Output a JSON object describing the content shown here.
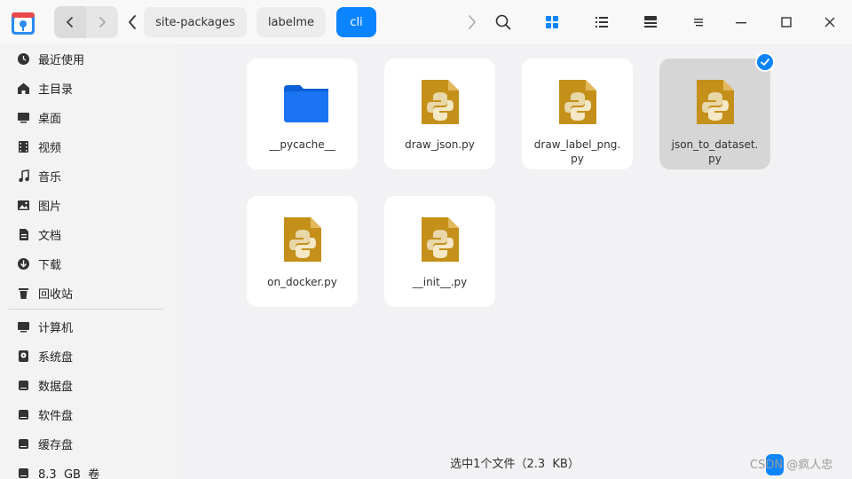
{
  "toolbar": {
    "app_icon": "file-manager-icon",
    "back_icon": "chevron-left-icon",
    "forward_icon": "chevron-right-icon",
    "breadcrumbs": [
      {
        "label": "site-packages",
        "active": false
      },
      {
        "label": "labelme",
        "active": false
      },
      {
        "label": "cli",
        "active": true
      }
    ],
    "accent": "#0a84ff"
  },
  "sidebar": {
    "items": [
      {
        "label": "最近使用",
        "icon": "recent-icon"
      },
      {
        "label": "主目录",
        "icon": "home-icon"
      },
      {
        "label": "桌面",
        "icon": "desktop-icon"
      },
      {
        "label": "视频",
        "icon": "video-icon"
      },
      {
        "label": "音乐",
        "icon": "music-icon"
      },
      {
        "label": "图片",
        "icon": "image-icon"
      },
      {
        "label": "文档",
        "icon": "document-icon"
      },
      {
        "label": "下载",
        "icon": "download-icon"
      },
      {
        "label": "回收站",
        "icon": "trash-icon"
      }
    ],
    "devices": [
      {
        "label": "计算机",
        "icon": "computer-icon"
      },
      {
        "label": "系统盘",
        "icon": "system-disk-icon"
      },
      {
        "label": "数据盘",
        "icon": "disk-icon"
      },
      {
        "label": "软件盘",
        "icon": "disk-icon"
      },
      {
        "label": "缓存盘",
        "icon": "disk-icon"
      },
      {
        "label": "8.3  GB  卷",
        "icon": "disk-icon"
      }
    ]
  },
  "files": [
    {
      "name": "__pycache__",
      "type": "folder",
      "selected": false
    },
    {
      "name": "draw_json.py",
      "type": "python",
      "selected": false
    },
    {
      "name": "draw_label_png.\npy",
      "type": "python",
      "selected": false
    },
    {
      "name": "json_to_dataset.\npy",
      "type": "python",
      "selected": true
    },
    {
      "name": "on_docker.py",
      "type": "python",
      "selected": false
    },
    {
      "name": "__init__.py",
      "type": "python",
      "selected": false
    }
  ],
  "status": {
    "text": "选中1个文件（2.3  KB）"
  },
  "watermark": {
    "text": "CSDN @疯人忠"
  }
}
